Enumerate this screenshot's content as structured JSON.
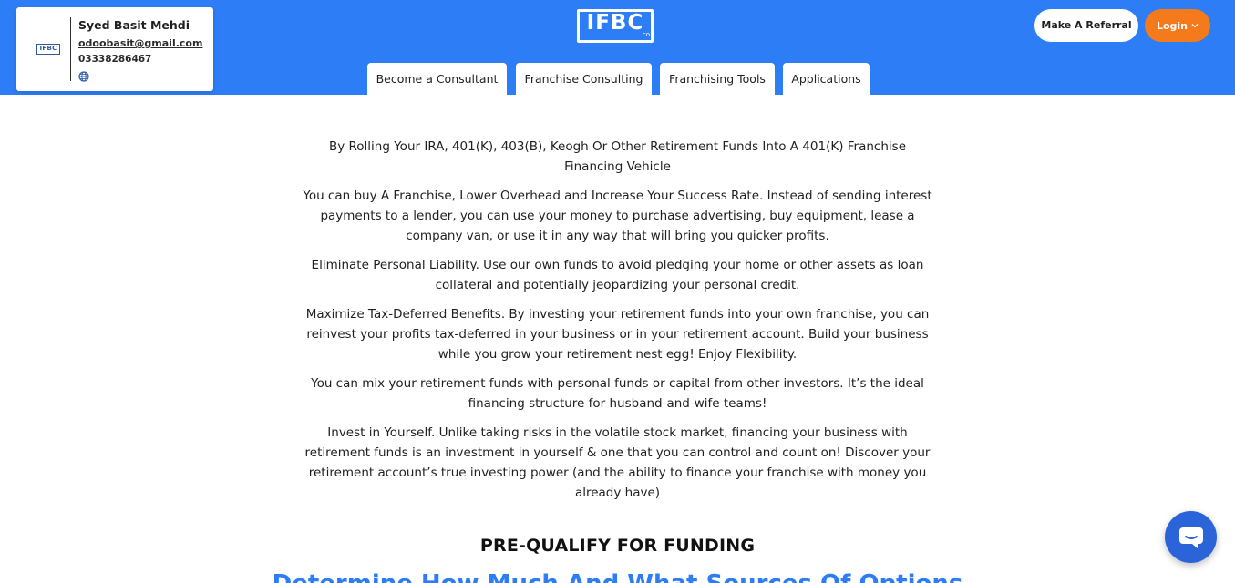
{
  "profile": {
    "logo_text": "IFBC",
    "name": "Syed Basit Mehdi",
    "email": "odoobasit@gmail.com",
    "phone": "03338286467",
    "globe_icon": "globe-icon"
  },
  "brand": {
    "logo_text": "IFBC",
    "logo_sub": ".co"
  },
  "header_buttons": {
    "referral_label": "Make A Referral",
    "login_label": "Login"
  },
  "nav_tabs": [
    {
      "label": "Become a Consultant"
    },
    {
      "label": "Franchise Consulting"
    },
    {
      "label": "Franchising Tools"
    },
    {
      "label": "Applications"
    }
  ],
  "content": {
    "paragraphs": [
      "By Rolling Your IRA, 401(K), 403(B), Keogh Or Other Retirement Funds Into A 401(K) Franchise Financing Vehicle",
      "You can buy A Franchise, Lower Overhead and Increase Your Success Rate. Instead of sending interest payments to a lender, you can use your money to purchase advertising, buy equipment, lease a company van, or use it in any way that will bring you quicker profits.",
      "Eliminate Personal Liability. Use our own funds to avoid pledging your home or other assets as loan collateral and potentially jeopardizing your personal credit.",
      "Maximize Tax-Deferred Benefits. By investing your retirement funds into your own franchise, you can reinvest your profits tax-deferred in your business or in your retirement account. Build your business while you grow your retirement nest egg! Enjoy Flexibility.",
      "You can mix your retirement funds with personal funds or capital from other investors. It’s the ideal financing structure for husband-and-wife teams!",
      "Invest in Yourself. Unlike taking risks in the volatile stock market, financing your business with retirement funds is an investment in yourself & one that you can control and count on! Discover your retirement account’s true investing power (and the ability to finance your franchise with money you already have)"
    ],
    "heading": "PRE-QUALIFY FOR FUNDING",
    "subheading": "Determine How Much And What Sources Of Options"
  },
  "colors": {
    "brand_blue": "#2d7df6",
    "login_orange": "#f57a1c",
    "chat_blue": "#2b63d9"
  },
  "chat": {
    "icon": "chat-bubble-icon"
  }
}
